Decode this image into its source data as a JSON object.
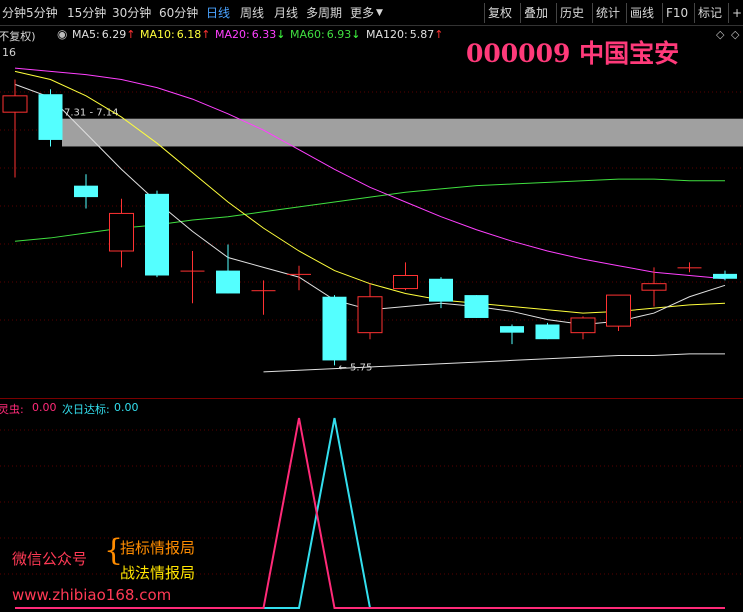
{
  "toolbar": {
    "periods": [
      "分钟",
      "5分钟",
      "15分钟",
      "30分钟",
      "60分钟",
      "日线",
      "周线",
      "月线",
      "多周期",
      "更多"
    ],
    "active_period": "日线",
    "right_buttons": [
      "复权",
      "叠加",
      "历史",
      "统计",
      "画线",
      "F10",
      "标记",
      "+自"
    ]
  },
  "ma_bar": {
    "mode": "(不复权)",
    "ma5": {
      "label": "MA5:",
      "value": "6.29",
      "arrow": "↑",
      "color": "#e0e0e0"
    },
    "ma10": {
      "label": "MA10:",
      "value": "6.18",
      "arrow": "↑",
      "color": "#ffff3c"
    },
    "ma20": {
      "label": "MA20:",
      "value": "6.33",
      "arrow": "↓",
      "color": "#ff40ff"
    },
    "ma60": {
      "label": "MA60:",
      "value": "6.93",
      "arrow": "↓",
      "color": "#40e040"
    },
    "ma120": {
      "label": "MA120:",
      "value": "5.87",
      "arrow": "↑",
      "color": "#e0e0e0"
    }
  },
  "axis_fragment": "16",
  "stock_title": "000009 中国宝安",
  "gap_label": "7.31 - 7.14",
  "low_label": "5.75",
  "indicator": {
    "name": "灵虫:",
    "value": "0.00",
    "next_label": "次日达标:",
    "next_value": "0.00"
  },
  "watermark": {
    "wechat_label": "微信公众号",
    "line1": "指标情报局",
    "line2": "战法情报局",
    "site": "www.zhibiao168.com"
  },
  "colors": {
    "up": "#ff3232",
    "down": "#54ffff",
    "ma5": "#e0e0e0",
    "ma10": "#ffff3c",
    "ma20": "#ff40ff",
    "ma60": "#40e040",
    "gap_band": "#a0a0a0",
    "indicator_a": "#ff2a78",
    "indicator_b": "#33dfee"
  },
  "chart_data": {
    "type": "candlestick",
    "price_range": [
      5.6,
      7.7
    ],
    "candles": [
      {
        "o": 7.35,
        "c": 7.45,
        "h": 7.55,
        "l": 6.95
      },
      {
        "o": 7.46,
        "c": 7.18,
        "h": 7.49,
        "l": 7.14
      },
      {
        "o": 6.9,
        "c": 6.83,
        "h": 6.97,
        "l": 6.76
      },
      {
        "o": 6.5,
        "c": 6.73,
        "h": 6.82,
        "l": 6.4
      },
      {
        "o": 6.85,
        "c": 6.35,
        "h": 6.87,
        "l": 6.34
      },
      {
        "o": 6.38,
        "c": 6.38,
        "h": 6.5,
        "l": 6.18
      },
      {
        "o": 6.38,
        "c": 6.24,
        "h": 6.54,
        "l": 6.24
      },
      {
        "o": 6.26,
        "c": 6.26,
        "h": 6.32,
        "l": 6.11
      },
      {
        "o": 6.36,
        "c": 6.36,
        "h": 6.41,
        "l": 6.26
      },
      {
        "o": 6.22,
        "c": 5.83,
        "h": 6.23,
        "l": 5.8
      },
      {
        "o": 6.0,
        "c": 6.22,
        "h": 6.3,
        "l": 5.96
      },
      {
        "o": 6.27,
        "c": 6.35,
        "h": 6.43,
        "l": 6.26
      },
      {
        "o": 6.33,
        "c": 6.19,
        "h": 6.34,
        "l": 6.15
      },
      {
        "o": 6.23,
        "c": 6.09,
        "h": 6.23,
        "l": 6.09
      },
      {
        "o": 6.04,
        "c": 6.0,
        "h": 6.05,
        "l": 5.93
      },
      {
        "o": 6.05,
        "c": 5.96,
        "h": 6.06,
        "l": 5.96
      },
      {
        "o": 6.0,
        "c": 6.09,
        "h": 6.1,
        "l": 5.96
      },
      {
        "o": 6.04,
        "c": 6.23,
        "h": 6.23,
        "l": 6.01
      },
      {
        "o": 6.26,
        "c": 6.3,
        "h": 6.4,
        "l": 6.16
      },
      {
        "o": 6.4,
        "c": 6.4,
        "h": 6.43,
        "l": 6.37
      },
      {
        "o": 6.36,
        "c": 6.33,
        "h": 6.38,
        "l": 6.32
      }
    ],
    "ma5": [
      7.52,
      7.44,
      7.22,
      7.0,
      6.8,
      6.62,
      6.46,
      6.4,
      6.34,
      6.2,
      6.14,
      6.16,
      6.18,
      6.16,
      6.13,
      6.08,
      6.05,
      6.07,
      6.12,
      6.22,
      6.29
    ],
    "ma10": [
      7.6,
      7.55,
      7.45,
      7.32,
      7.16,
      6.98,
      6.8,
      6.64,
      6.5,
      6.38,
      6.3,
      6.24,
      6.2,
      6.18,
      6.16,
      6.14,
      6.12,
      6.13,
      6.15,
      6.17,
      6.18
    ],
    "ma20": [
      7.62,
      7.6,
      7.58,
      7.55,
      7.5,
      7.43,
      7.34,
      7.24,
      7.12,
      7.0,
      6.89,
      6.8,
      6.71,
      6.63,
      6.56,
      6.5,
      6.45,
      6.41,
      6.37,
      6.35,
      6.33
    ],
    "ma60": [
      6.56,
      6.58,
      6.61,
      6.64,
      6.66,
      6.69,
      6.71,
      6.74,
      6.77,
      6.8,
      6.83,
      6.86,
      6.88,
      6.9,
      6.91,
      6.92,
      6.93,
      6.94,
      6.94,
      6.93,
      6.93
    ],
    "ma120": [
      null,
      null,
      null,
      null,
      null,
      null,
      null,
      5.76,
      5.77,
      5.78,
      5.79,
      5.8,
      5.81,
      5.82,
      5.83,
      5.84,
      5.85,
      5.86,
      5.86,
      5.87,
      5.87
    ],
    "gap_band": [
      7.14,
      7.31
    ],
    "indicator_range": [
      0,
      1
    ],
    "indicator_a": [
      0,
      0,
      0,
      0,
      0,
      0,
      0,
      0,
      1,
      0,
      0,
      0,
      0,
      0,
      0,
      0,
      0,
      0,
      0,
      0,
      0
    ],
    "indicator_b": [
      0,
      0,
      0,
      0,
      0,
      0,
      0,
      0,
      0,
      1,
      0,
      0,
      0,
      0,
      0,
      0,
      0,
      0,
      0,
      0,
      0
    ]
  }
}
